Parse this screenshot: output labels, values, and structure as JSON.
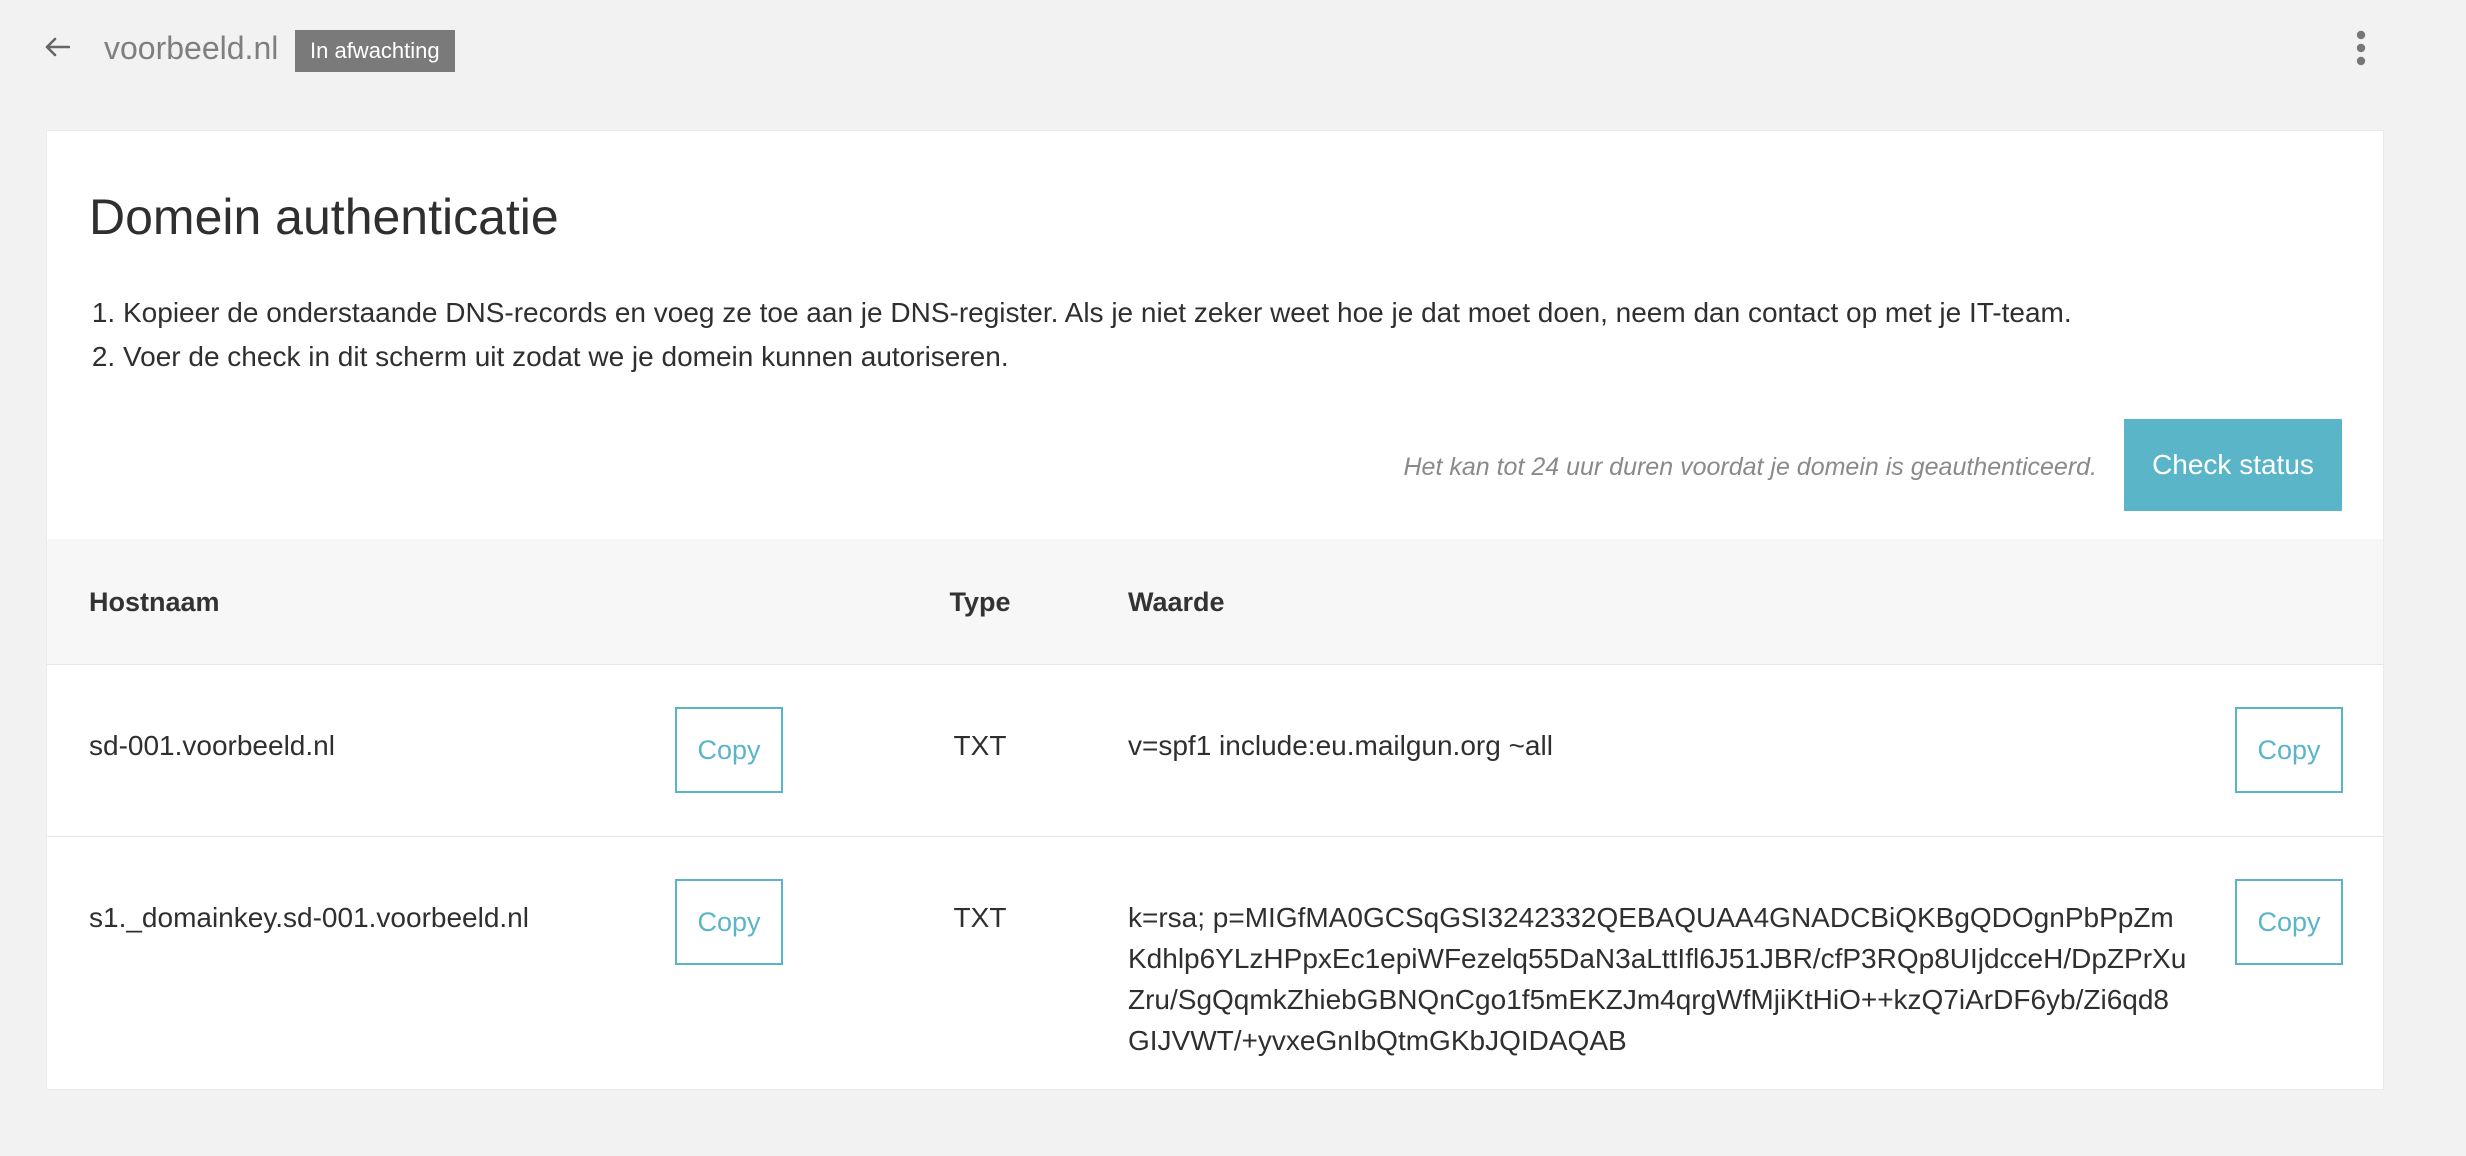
{
  "header": {
    "domain": "voorbeeld.nl",
    "status_badge": "In afwachting",
    "back_icon": "arrow-left-icon",
    "more_icon": "more-vertical-icon"
  },
  "card": {
    "title": "Domein authenticatie",
    "steps": [
      "Kopieer de onderstaande DNS-records en voeg ze toe aan je DNS-register. Als je niet zeker weet hoe je dat moet doen, neem dan contact op met je IT-team.",
      "Voer de check in dit scherm uit zodat we je domein kunnen autoriseren."
    ],
    "notice": "Het kan tot 24 uur duren voordat je domein is geauthenticeerd.",
    "check_button": "Check status"
  },
  "table": {
    "columns": {
      "host": "Hostnaam",
      "type": "Type",
      "value": "Waarde"
    },
    "rows": [
      {
        "host": "sd-001.voorbeeld.nl",
        "type": "TXT",
        "value": "v=spf1 include:eu.mailgun.org ~all",
        "copy_label": "Copy"
      },
      {
        "host": "s1._domainkey.sd-001.voorbeeld.nl",
        "type": "TXT",
        "value": "k=rsa; p=MIGfMA0GCSqGSI3242332QEBAQUAA4GNADCBiQKBgQDOgnPbPpZmKdhlp6YLzHPpxEc1epiWFezelq55DaN3aLttIfl6J51JBR/cfP3RQp8UIjdcceH/DpZPrXuZru/SgQqmkZhiebGBNQnCgo1f5mEKZJm4qrgWfMjiKtHiO++kzQ7iArDF6yb/Zi6qd8GIJVWT/+yvxeGnIbQtmGKbJQIDAQAB",
        "copy_label": "Copy"
      }
    ]
  },
  "colors": {
    "accent": "#5ab5c8",
    "badge": "#7a7a7a",
    "background": "#f2f2f3"
  }
}
